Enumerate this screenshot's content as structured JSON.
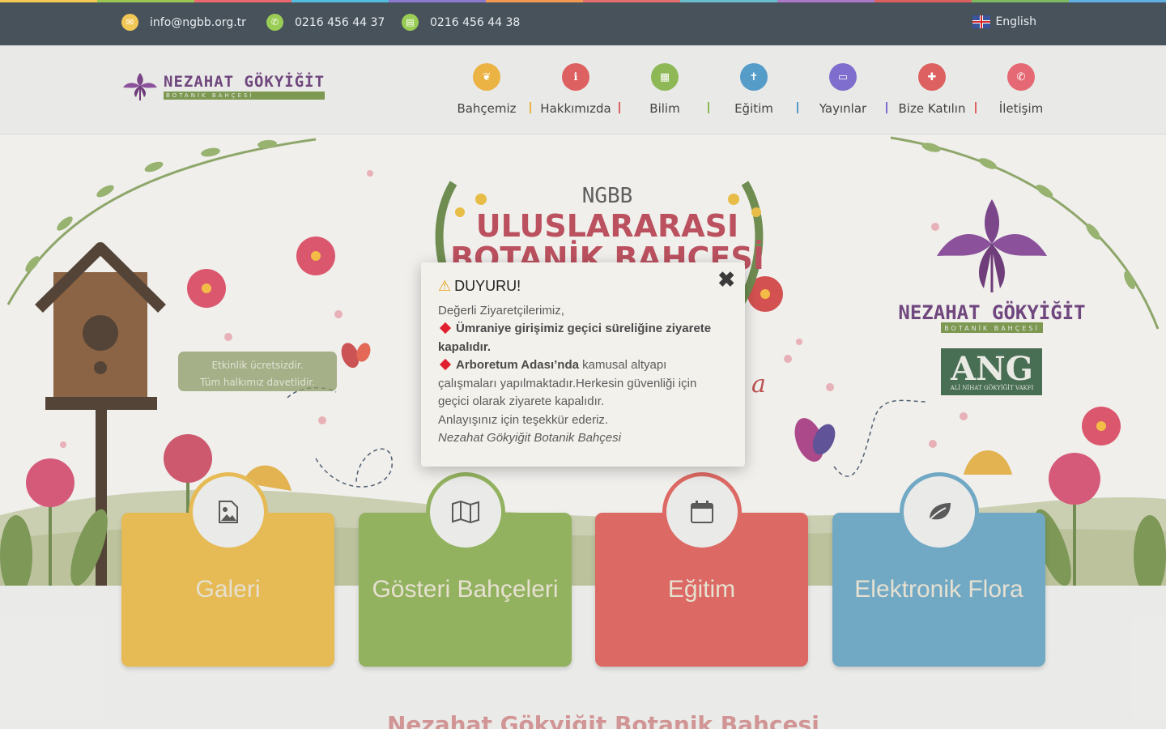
{
  "colors": {
    "rainbow": [
      "#f3c23c",
      "#8cbf3c",
      "#e9545a",
      "#3db4d9",
      "#7b67c8",
      "#ef8b3b",
      "#e05a5a",
      "#56b6c4",
      "#a066c0",
      "#d54a4a",
      "#6ab04c",
      "#4aa3df"
    ],
    "topbar": "#2e3b45",
    "accent_red": "#b4393a"
  },
  "topbar": {
    "email": "info@ngbb.org.tr",
    "phone": "0216 456 44 37",
    "fax": "0216 456 44 38",
    "language": "English"
  },
  "header": {
    "logo": {
      "title": "NEZAHAT GÖKYİĞİT",
      "subtitle": "BOTANİK BAHÇESİ"
    },
    "nav": [
      {
        "label": "Bahçemiz",
        "icon": "leaf-icon",
        "color": "#e9a92b"
      },
      {
        "label": "Hakkımızda",
        "icon": "info-icon",
        "color": "#d94c4c"
      },
      {
        "label": "Bilim",
        "icon": "grid-icon",
        "color": "#7fae3e"
      },
      {
        "label": "Eğitim",
        "icon": "person-icon",
        "color": "#3f8fc2"
      },
      {
        "label": "Yayınlar",
        "icon": "book-icon",
        "color": "#6e5bc7"
      },
      {
        "label": "Bize Katılın",
        "icon": "puzzle-icon",
        "color": "#d94c4c"
      },
      {
        "label": "İletişim",
        "icon": "phone-icon",
        "color": "#e25561"
      }
    ]
  },
  "hero": {
    "badge_line1": "Etkinlik ücretsizdir.",
    "badge_line2": "Tüm halkımız davetlidir."
  },
  "cards": [
    {
      "title": "Galeri",
      "color": "#e3b13e",
      "icon": "image-icon"
    },
    {
      "title": "Gösteri Bahçeleri",
      "color": "#85a84a",
      "icon": "map-icon"
    },
    {
      "title": "Eğitim",
      "color": "#d9554f",
      "icon": "calendar-icon"
    },
    {
      "title": "Elektronik Flora",
      "color": "#5e9ebd",
      "icon": "leaf-icon"
    }
  ],
  "below_heading": "Nezahat Gökyiğit Botanik Bahçesi",
  "modal": {
    "title": "DUYURU!",
    "greeting": "Değerli Ziyaretçilerimiz,",
    "p1_bold": "Ümraniye girişimiz geçici süreliğine ziyarete kapalıdır.",
    "p2_bold": "Arboretum Adası’nda",
    "p2_rest": " kamusal altyapı çalışmaları yapılmaktadır.Herkesin güvenliği için geçici olarak ziyarete kapalıdır.",
    "thanks": "Anlayışınız için teşekkür ederiz.",
    "signature": "Nezahat Gökyiğit Botanik Bahçesi",
    "close_glyph": "✖"
  }
}
